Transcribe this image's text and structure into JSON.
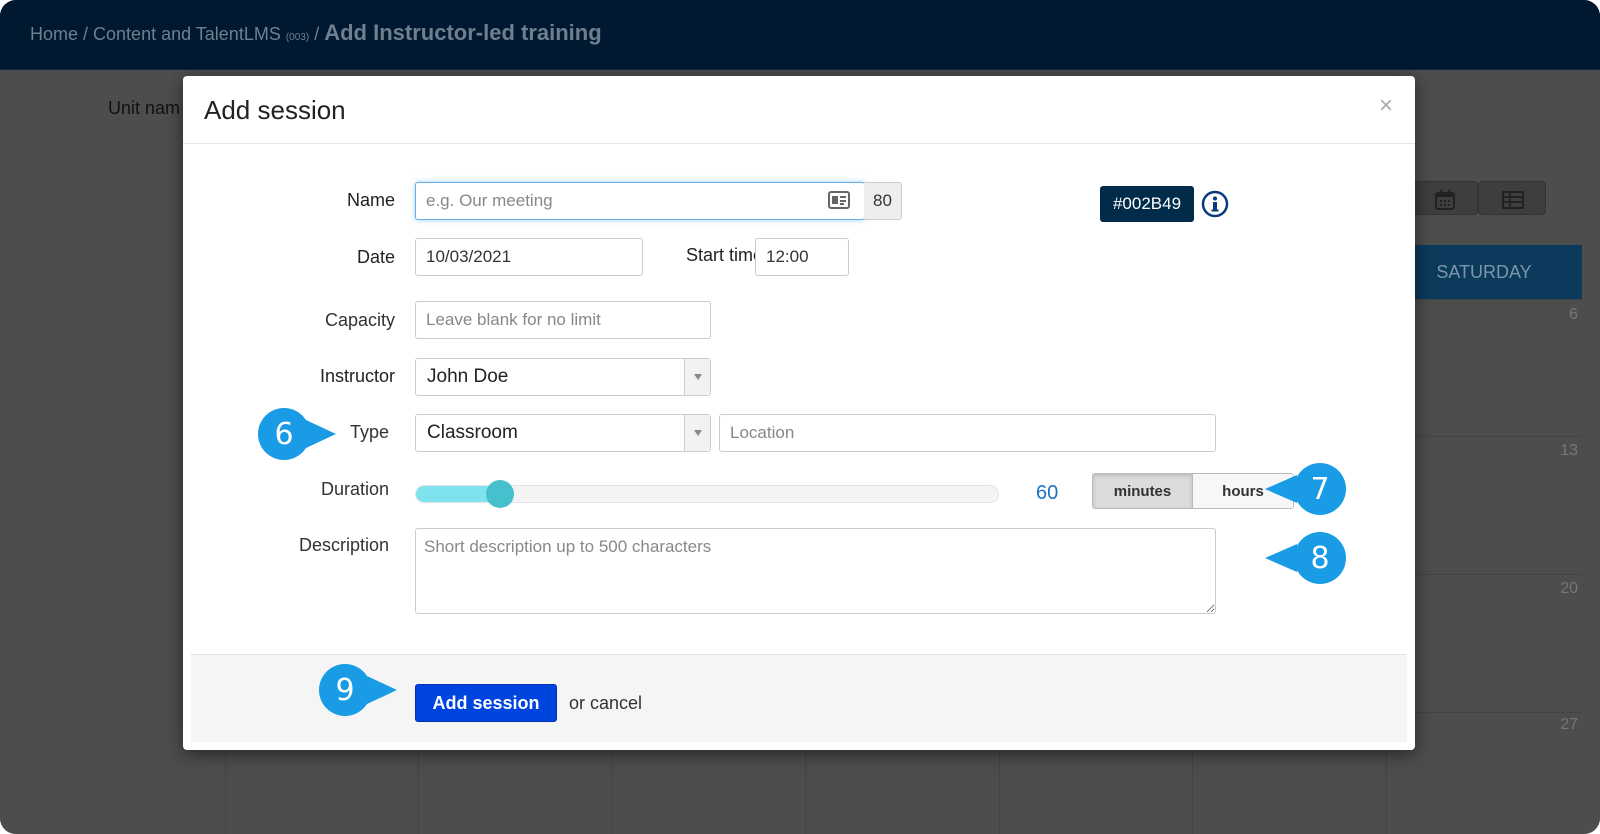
{
  "breadcrumb": {
    "home": "Home",
    "separator": " / ",
    "course": "Content and TalentLMS",
    "course_code": "(003)",
    "current": "Add Instructor-led training"
  },
  "page": {
    "unit_label": "Unit nam",
    "calendar": {
      "day_header": "SATURDAY",
      "day_numbers": [
        "6",
        "13",
        "20",
        "27"
      ]
    }
  },
  "modal": {
    "title": "Add session",
    "close": "×",
    "form": {
      "name": {
        "label": "Name",
        "placeholder": "e.g. Our meeting",
        "char_limit": "80"
      },
      "color": {
        "value": "#002B49"
      },
      "date": {
        "label": "Date",
        "value": "10/03/2021"
      },
      "start_time": {
        "label": "Start time",
        "value": "12:00"
      },
      "capacity": {
        "label": "Capacity",
        "placeholder": "Leave blank for no limit"
      },
      "instructor": {
        "label": "Instructor",
        "selected": "John Doe"
      },
      "type": {
        "label": "Type",
        "selected": "Classroom",
        "location_placeholder": "Location"
      },
      "duration": {
        "label": "Duration",
        "value": "60",
        "slider_fraction": 0.145,
        "units": [
          "minutes",
          "hours"
        ],
        "active_unit": "minutes"
      },
      "description": {
        "label": "Description",
        "placeholder": "Short description up to 500 characters"
      }
    },
    "footer": {
      "submit": "Add session",
      "cancel": "or cancel"
    }
  },
  "callouts": [
    "6",
    "7",
    "8",
    "9"
  ],
  "colors": {
    "topbar": "#001931",
    "accent": "#0044e0",
    "callout": "#1a9be6",
    "slider_fill": "#7ee3ee",
    "slider_handle": "#45c0cc",
    "color_chip": "#002b49"
  },
  "icons": [
    "card-icon",
    "info-icon",
    "chevron-down-icon",
    "calendar-icon",
    "table-icon",
    "close-icon"
  ]
}
